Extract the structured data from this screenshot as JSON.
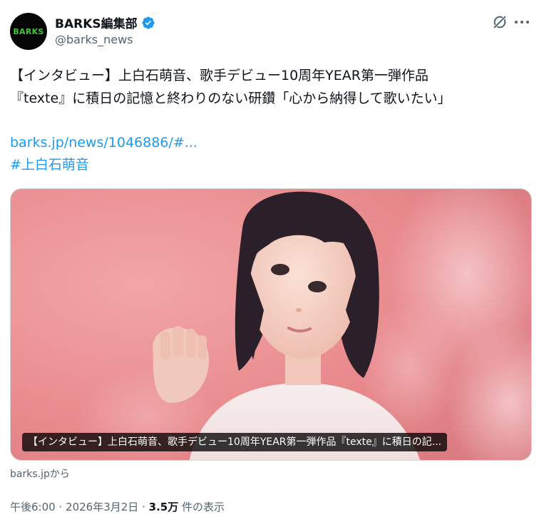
{
  "author": {
    "avatar_text": "BARKS",
    "display_name": "BARKS編集部",
    "handle": "@barks_news"
  },
  "tweet": {
    "text_line1": "【インタビュー】上白石萌音、歌手デビュー10周年YEAR第一弾作品",
    "text_line2": "『texte』に積日の記憶と終わりのない研鑽「心から納得して歌いたい」",
    "link": "barks.jp/news/1046886/#...",
    "hashtag": "#上白石萌音"
  },
  "card": {
    "caption": "【インタビュー】上白石萌音、歌手デビュー10周年YEAR第一弾作品『texte』に積日の記...",
    "source": "barks.jpから"
  },
  "meta": {
    "time": "午後6:00",
    "separator": "·",
    "date": "2026年3月2日",
    "views_count": "3.5万",
    "views_label": "件の表示"
  },
  "icons": {
    "verified": "verified-badge-icon",
    "grok": "grok-icon",
    "more": "more-options-icon"
  },
  "colors": {
    "link": "#1d9bf0",
    "verified": "#1d9bf0",
    "secondary_text": "#536471",
    "photo_background": "#ec9a9c"
  }
}
